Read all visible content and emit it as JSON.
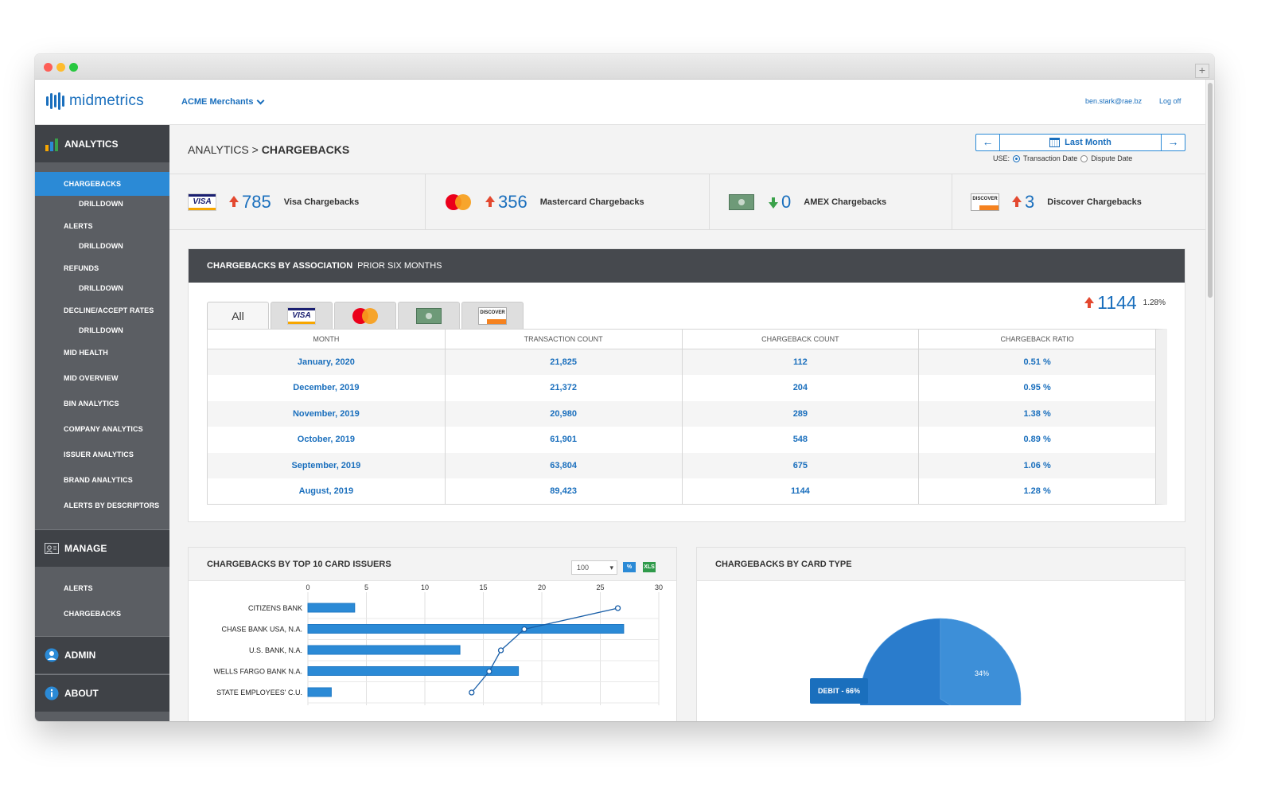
{
  "app": {
    "brand": "midmetrics",
    "merchant": "ACME Merchants",
    "user_email": "ben.stark@rae.bz",
    "logoff": "Log off"
  },
  "sidebar": {
    "analytics": "ANALYTICS",
    "items": [
      {
        "label": "CHARGEBACKS"
      },
      {
        "label": "DRILLDOWN"
      },
      {
        "label": "ALERTS"
      },
      {
        "label": "DRILLDOWN"
      },
      {
        "label": "REFUNDS"
      },
      {
        "label": "DRILLDOWN"
      },
      {
        "label": "DECLINE/ACCEPT RATES"
      },
      {
        "label": "DRILLDOWN"
      },
      {
        "label": "MID HEALTH"
      },
      {
        "label": "MID OVERVIEW"
      },
      {
        "label": "BIN ANALYTICS"
      },
      {
        "label": "COMPANY ANALYTICS"
      },
      {
        "label": "ISSUER ANALYTICS"
      },
      {
        "label": "BRAND ANALYTICS"
      },
      {
        "label": "ALERTS BY DESCRIPTORS"
      }
    ],
    "manage": "MANAGE",
    "manage_items": [
      {
        "label": "ALERTS"
      },
      {
        "label": "CHARGEBACKS"
      }
    ],
    "admin": "ADMIN",
    "about": "ABOUT"
  },
  "page": {
    "breadcrumb_parent": "ANALYTICS",
    "breadcrumb_sep": " > ",
    "breadcrumb_current": "CHARGEBACKS",
    "date_range": "Last Month",
    "use_label": "USE:",
    "use_options": [
      "Transaction Date",
      "Dispute Date"
    ],
    "use_selected": "Transaction Date"
  },
  "kpis": [
    {
      "brand": "visa",
      "direction": "up",
      "value": "785",
      "label": "Visa Chargebacks"
    },
    {
      "brand": "mastercard",
      "direction": "up",
      "value": "356",
      "label": "Mastercard Chargebacks"
    },
    {
      "brand": "amex",
      "direction": "down",
      "value": "0",
      "label": "AMEX Chargebacks"
    },
    {
      "brand": "discover",
      "direction": "up",
      "value": "3",
      "label": "Discover Chargebacks"
    }
  ],
  "association_panel": {
    "title": "CHARGEBACKS BY ASSOCIATION",
    "subtitle": "PRIOR SIX MONTHS",
    "tabs": [
      "All",
      "visa",
      "mastercard",
      "amex",
      "discover"
    ],
    "active_tab": "All",
    "total_value": "1144",
    "total_pct": "1.28%",
    "columns": [
      "MONTH",
      "TRANSACTION COUNT",
      "CHARGEBACK COUNT",
      "CHARGEBACK RATIO"
    ],
    "rows": [
      [
        "January, 2020",
        "21,825",
        "112",
        "0.51 %"
      ],
      [
        "December, 2019",
        "21,372",
        "204",
        "0.95 %"
      ],
      [
        "November, 2019",
        "20,980",
        "289",
        "1.38 %"
      ],
      [
        "October, 2019",
        "61,901",
        "548",
        "0.89 %"
      ],
      [
        "September, 2019",
        "63,804",
        "675",
        "1.06 %"
      ],
      [
        "August, 2019",
        "89,423",
        "1144",
        "1.28 %"
      ]
    ]
  },
  "issuers_panel": {
    "title": "CHARGEBACKS BY TOP 10 CARD ISSUERS",
    "page_size": "100",
    "tool_percent": "%",
    "tool_xls": "XLS"
  },
  "card_type_panel": {
    "title": "CHARGEBACKS BY CARD TYPE",
    "debit_tag": "DEBIT - 66%",
    "credit_pct": "34%"
  },
  "chart_data": [
    {
      "type": "bar",
      "orientation": "horizontal",
      "categories": [
        "CITIZENS BANK",
        "CHASE BANK USA, N.A.",
        "U.S. BANK, N.A.",
        "WELLS FARGO BANK N.A.",
        "STATE EMPLOYEES' C.U."
      ],
      "values": [
        4,
        27,
        13,
        18,
        2
      ],
      "line_values": [
        26.5,
        18.5,
        16.5,
        15.5,
        14
      ],
      "xlim": [
        0,
        30
      ],
      "xticks": [
        0,
        5,
        10,
        15,
        20,
        25,
        30
      ],
      "grid": true,
      "colors": {
        "bar": "#2b8ad6",
        "line": "#1a5fa8"
      }
    },
    {
      "type": "pie",
      "labels": [
        "DEBIT",
        "CREDIT"
      ],
      "values": [
        66,
        34
      ],
      "colors": {
        "debit": "#2a7ccc",
        "credit": "#3d8fd8"
      }
    }
  ]
}
